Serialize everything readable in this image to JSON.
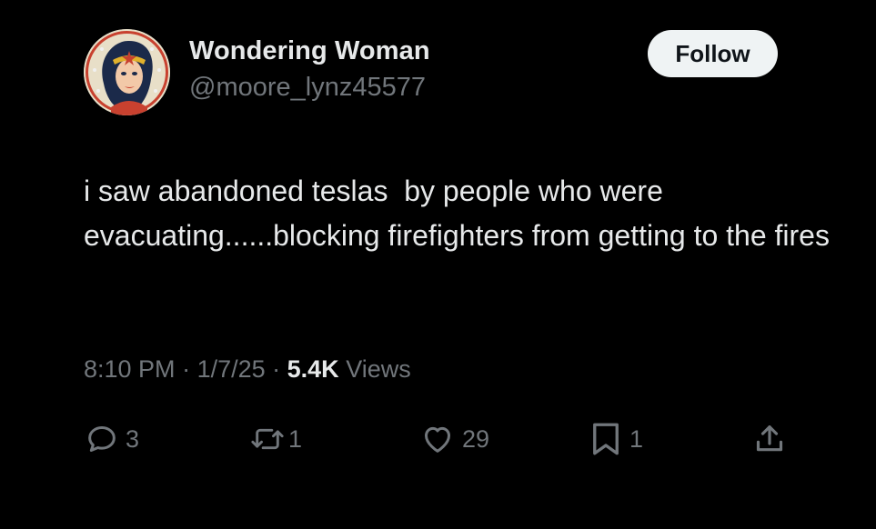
{
  "author": {
    "display_name": "Wondering Woman",
    "handle": "@moore_lynz45577",
    "avatar_icon": "wonder-woman-avatar"
  },
  "follow_label": "Follow",
  "tweet": {
    "text": "i saw abandoned teslas  by people who were evacuating......blocking firefighters from getting to the fires"
  },
  "meta": {
    "time": "8:10 PM",
    "separator": " · ",
    "date": "1/7/25",
    "views_count": "5.4K",
    "views_label": " Views"
  },
  "actions": {
    "replies": "3",
    "retweets": "1",
    "likes": "29",
    "bookmarks": "1"
  },
  "colors": {
    "background": "#000000",
    "primary_text": "#e7e9ea",
    "secondary_text": "#71767b",
    "follow_bg": "#eff3f4"
  }
}
